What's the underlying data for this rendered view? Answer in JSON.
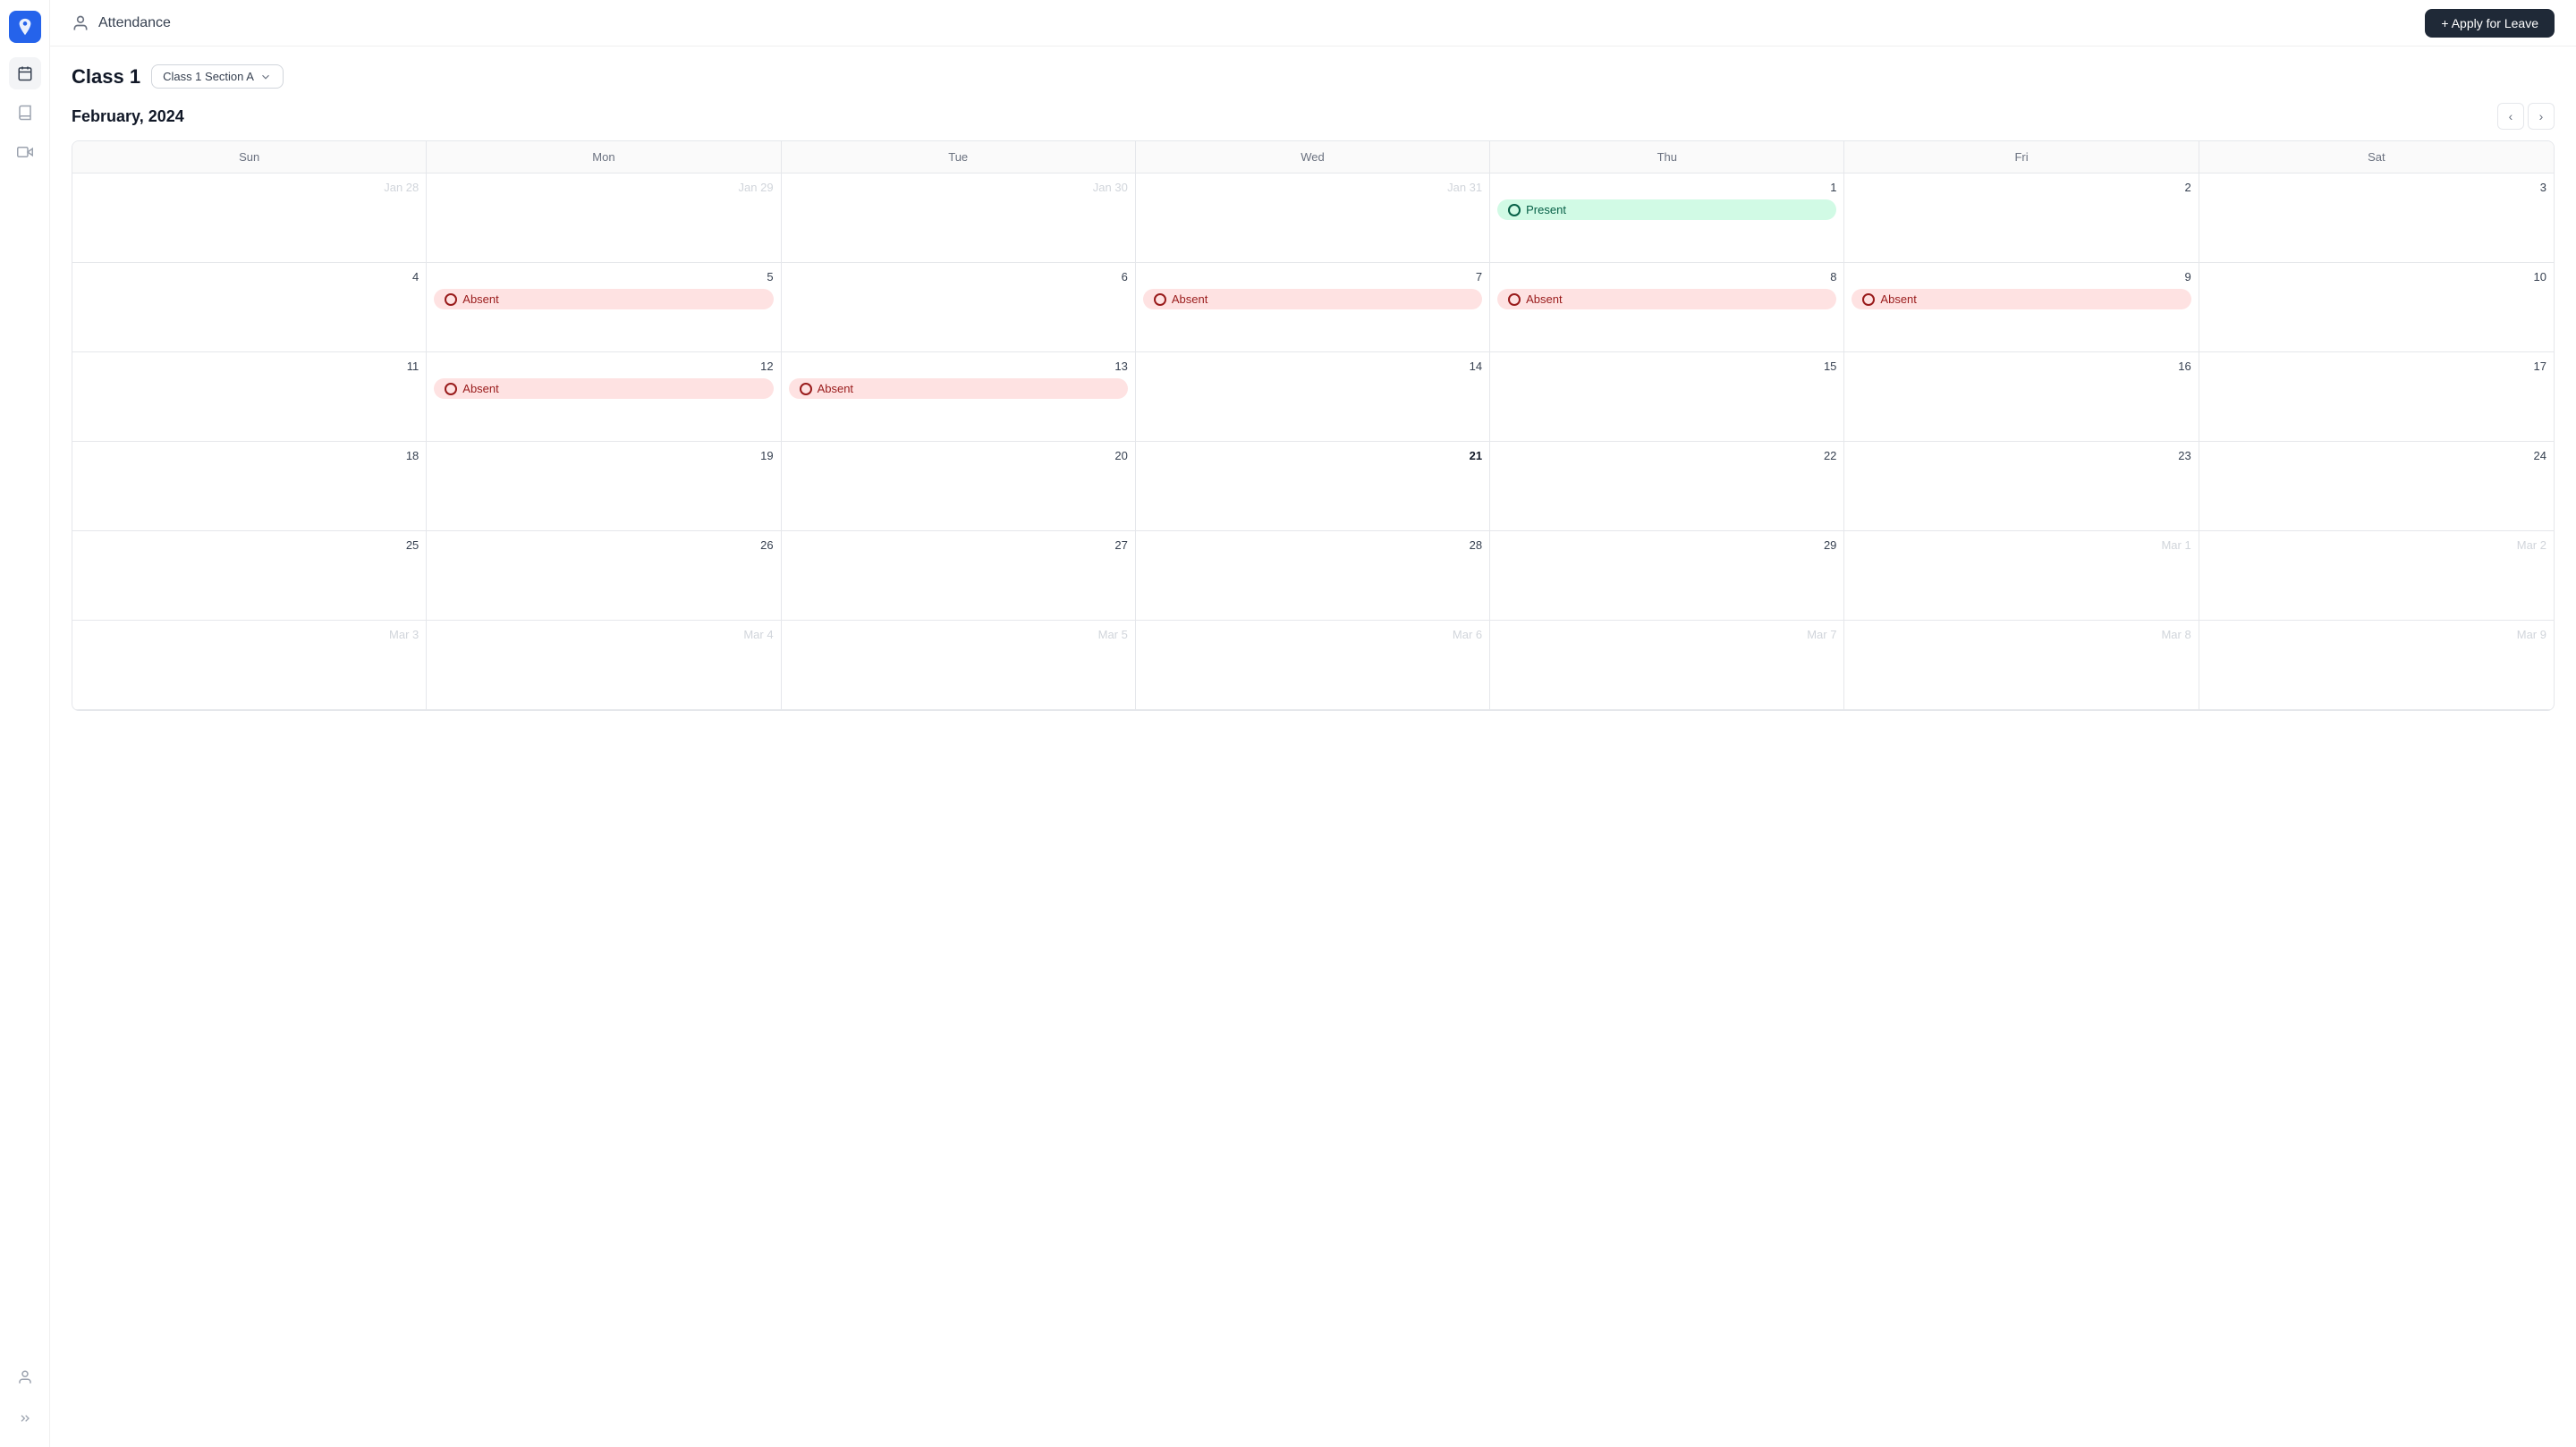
{
  "sidebar": {
    "logo_text": "S",
    "icons": [
      "calendar",
      "book",
      "video",
      "person"
    ],
    "active_index": 0
  },
  "header": {
    "title": "Attendance",
    "apply_button_label": "+ Apply for Leave"
  },
  "class_section": {
    "class_label": "Class 1",
    "section_value": "Class 1 Section A"
  },
  "calendar": {
    "month_title": "February, 2024",
    "day_headers": [
      "Sun",
      "Mon",
      "Tue",
      "Wed",
      "Thu",
      "Fri",
      "Sat"
    ],
    "weeks": [
      [
        {
          "date": "Jan 28",
          "other": true,
          "status": null
        },
        {
          "date": "Jan 29",
          "other": true,
          "status": null
        },
        {
          "date": "Jan 30",
          "other": true,
          "status": null
        },
        {
          "date": "Jan 31",
          "other": true,
          "status": null
        },
        {
          "date": "1",
          "other": false,
          "status": "Present"
        },
        {
          "date": "2",
          "other": false,
          "status": null
        },
        {
          "date": "3",
          "other": false,
          "status": null
        }
      ],
      [
        {
          "date": "4",
          "other": false,
          "status": null
        },
        {
          "date": "5",
          "other": false,
          "status": "Absent"
        },
        {
          "date": "6",
          "other": false,
          "status": null
        },
        {
          "date": "7",
          "other": false,
          "status": "Absent"
        },
        {
          "date": "8",
          "other": false,
          "status": "Absent"
        },
        {
          "date": "9",
          "other": false,
          "status": "Absent"
        },
        {
          "date": "10",
          "other": false,
          "status": null
        }
      ],
      [
        {
          "date": "11",
          "other": false,
          "status": null
        },
        {
          "date": "12",
          "other": false,
          "status": "Absent"
        },
        {
          "date": "13",
          "other": false,
          "status": "Absent"
        },
        {
          "date": "14",
          "other": false,
          "status": null
        },
        {
          "date": "15",
          "other": false,
          "status": null
        },
        {
          "date": "16",
          "other": false,
          "status": null
        },
        {
          "date": "17",
          "other": false,
          "status": null
        }
      ],
      [
        {
          "date": "18",
          "other": false,
          "status": null
        },
        {
          "date": "19",
          "other": false,
          "status": null
        },
        {
          "date": "20",
          "other": false,
          "status": null
        },
        {
          "date": "21",
          "other": false,
          "today": true,
          "status": null
        },
        {
          "date": "22",
          "other": false,
          "status": null
        },
        {
          "date": "23",
          "other": false,
          "status": null
        },
        {
          "date": "24",
          "other": false,
          "status": null
        }
      ],
      [
        {
          "date": "25",
          "other": false,
          "status": null
        },
        {
          "date": "26",
          "other": false,
          "status": null
        },
        {
          "date": "27",
          "other": false,
          "status": null
        },
        {
          "date": "28",
          "other": false,
          "status": null
        },
        {
          "date": "29",
          "other": false,
          "status": null
        },
        {
          "date": "Mar 1",
          "other": true,
          "status": null
        },
        {
          "date": "Mar 2",
          "other": true,
          "status": null
        }
      ],
      [
        {
          "date": "Mar 3",
          "other": true,
          "status": null
        },
        {
          "date": "Mar 4",
          "other": true,
          "status": null
        },
        {
          "date": "Mar 5",
          "other": true,
          "status": null
        },
        {
          "date": "Mar 6",
          "other": true,
          "status": null
        },
        {
          "date": "Mar 7",
          "other": true,
          "status": null
        },
        {
          "date": "Mar 8",
          "other": true,
          "status": null
        },
        {
          "date": "Mar 9",
          "other": true,
          "status": null
        }
      ]
    ]
  }
}
